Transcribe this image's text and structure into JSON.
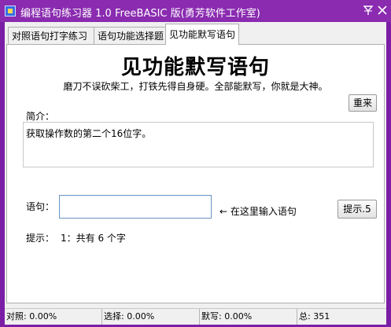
{
  "window": {
    "title": "编程语句练习器 1.0 FreeBASIC 版(勇芳软件工作室)"
  },
  "tabs": [
    {
      "label": "对照语句打字练习"
    },
    {
      "label": "语句功能选择题"
    },
    {
      "label": "见功能默写语句"
    }
  ],
  "main": {
    "title": "见功能默写语句",
    "subtitle": "磨刀不误砍柴工，打铁先得自身硬。全部能默写，你就是大神。",
    "restart_label": "重来",
    "intro_label": "简介：",
    "description": "获取操作数的第二个16位字。",
    "statement_label": "语句：",
    "statement_value": "",
    "input_hint": "← 在这里输入语句",
    "hint_button_label": "提示.5",
    "tip_label": "提示：",
    "tip_text": "1：共有 6 个字"
  },
  "status": {
    "contrast": "对照: 0.00%",
    "choice": "选择: 0.00%",
    "dictation": "默写: 0.00%",
    "total": "总: 351"
  },
  "colors": {
    "titlebar": "#8a2bb0",
    "frame": "#7b1ea6",
    "input_border": "#6a93c8"
  }
}
